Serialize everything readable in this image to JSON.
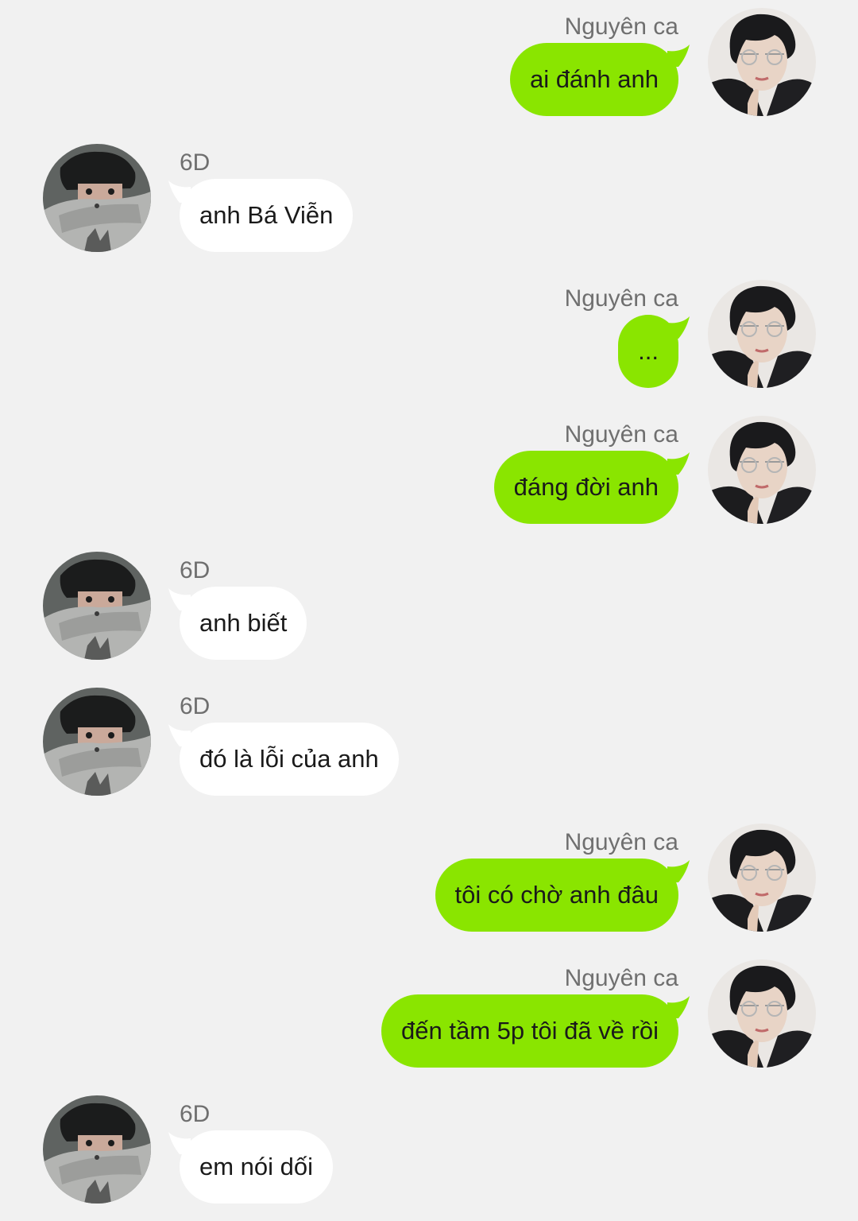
{
  "conversation": {
    "messages": [
      {
        "direction": "out",
        "sender": "Nguyên ca",
        "text": "ai đánh anh"
      },
      {
        "direction": "in",
        "sender": "6D",
        "text": "anh Bá Viễn"
      },
      {
        "direction": "out",
        "sender": "Nguyên ca",
        "text": "..."
      },
      {
        "direction": "out",
        "sender": "Nguyên ca",
        "text": "đáng đời anh"
      },
      {
        "direction": "in",
        "sender": "6D",
        "text": "anh biết"
      },
      {
        "direction": "in",
        "sender": "6D",
        "text": "đó là lỗi của anh"
      },
      {
        "direction": "out",
        "sender": "Nguyên ca",
        "text": "tôi có chờ anh đâu"
      },
      {
        "direction": "out",
        "sender": "Nguyên ca",
        "text": "đến tầm 5p tôi đã về rồi"
      },
      {
        "direction": "in",
        "sender": "6D",
        "text": "em nói dối"
      }
    ]
  },
  "colors": {
    "background": "#f1f1f1",
    "outgoing_bubble": "#8ae500",
    "incoming_bubble": "#ffffff",
    "sender_name": "#6f6f6f",
    "message_text": "#1a1a1a"
  },
  "icons": {
    "outgoing_avatar": "user-avatar-icon",
    "incoming_avatar": "contact-avatar-icon"
  }
}
